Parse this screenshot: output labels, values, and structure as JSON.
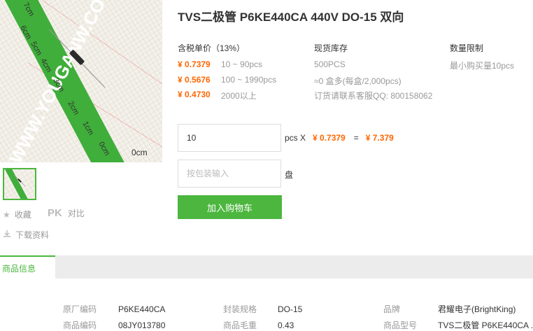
{
  "product": {
    "title": "TVS二极管 P6KE440CA 440V DO-15 双向"
  },
  "image": {
    "watermark_text": "WWW.YOUGANW.CO",
    "ruler_labels": [
      "7cm",
      "6cm",
      "5cm",
      "4cm",
      "3cm",
      "2cm",
      "1cm",
      "0cm"
    ],
    "bottom_ruler_label": "0cm"
  },
  "side_actions": {
    "favorite": "收藏",
    "compare_pk": "PK",
    "compare": "对比",
    "download": "下载资料"
  },
  "pricing": {
    "header": "含税单价（13%）",
    "tiers": [
      {
        "price": "¥ 0.7379",
        "range": "10 ~ 90pcs"
      },
      {
        "price": "¥ 0.5676",
        "range": "100 ~ 1990pcs"
      },
      {
        "price": "¥ 0.4730",
        "range": "2000以上"
      }
    ]
  },
  "stock": {
    "header": "现货库存",
    "lines": [
      "500PCS",
      "≈0 盒多(每盒/2,000pcs)",
      "订货请联系客服QQ: 800158062"
    ]
  },
  "limit": {
    "header": "数量限制",
    "text": "最小购买量10pcs"
  },
  "order": {
    "quantity": "10",
    "unit": "pcs X",
    "unit_price": "¥ 0.7379",
    "equals": "=",
    "total": "¥ 7.379",
    "pack_placeholder": "按包装输入",
    "pack_unit": "盘",
    "add_to_cart": "加入购物车"
  },
  "tabs": {
    "product_info": "商品信息"
  },
  "specs": [
    {
      "k": "原厂编码",
      "v": "P6KE440CA"
    },
    {
      "k": "封装规格",
      "v": "DO-15"
    },
    {
      "k": "品牌",
      "v": "君耀电子(BrightKing)"
    },
    {
      "k": "商品编码",
      "v": "08JY013780"
    },
    {
      "k": "商品毛重",
      "v": "0.43"
    },
    {
      "k": "商品型号",
      "v": "TVS二极管 P6KE440CA ."
    }
  ],
  "colors": {
    "brand_green": "#4cb63e",
    "price_orange": "#ff6600"
  }
}
